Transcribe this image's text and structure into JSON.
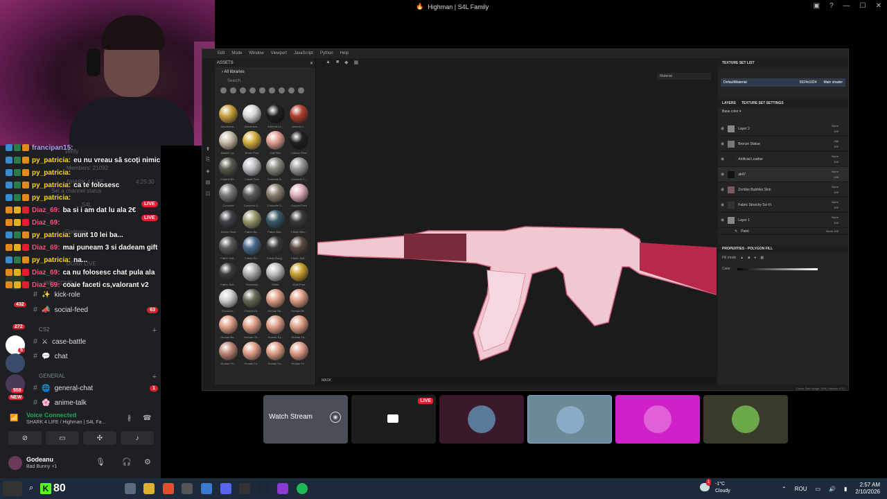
{
  "window": {
    "title": "Highman | S4L Family"
  },
  "chat": [
    {
      "user": "francipan15:",
      "msg": "",
      "color": "#bf94ff"
    },
    {
      "user": "py_patricia:",
      "msg": "eu nu vreau să scoți nimic",
      "color": "#ffd700"
    },
    {
      "user": "py_patricia:",
      "msg": "",
      "color": "#ffd700"
    },
    {
      "user": "py_patricia:",
      "msg": "ca te folosesc",
      "color": "#ffd700"
    },
    {
      "user": "py_patricia:",
      "msg": "",
      "color": "#ffd700"
    },
    {
      "user": "Diaz_69:",
      "msg": "ba si i am dat lu ala 2€",
      "color": "#ff4a7a"
    },
    {
      "user": "Diaz_69:",
      "msg": "",
      "color": "#ff4a7a"
    },
    {
      "user": "py_patricia:",
      "msg": "sunt 10 lei ba...",
      "color": "#ffd700"
    },
    {
      "user": "Diaz_69:",
      "msg": "mai puneam 3 si dadeam gift",
      "color": "#ff4a7a"
    },
    {
      "user": "py_patricia:",
      "msg": "na...",
      "color": "#ffd700"
    },
    {
      "user": "Diaz_69:",
      "msg": "ca nu folosesc chat pula ala",
      "color": "#ff4a7a"
    },
    {
      "user": "Diaz_69:",
      "msg": "coaie faceti cs,valorant v2",
      "color": "#ff4a7a"
    }
  ],
  "ghost": {
    "verify": "verify",
    "members": "Members: 21092",
    "shark": "SHARK 4 LIFE",
    "time": "4:25:30",
    "status": "Set a channel status",
    "s4l": "S4L",
    "godeanu": "Godeanu",
    "doar_live": "DOAR LIVE",
    "welcome": "WELCOME",
    "live": "LIVE"
  },
  "channels": [
    {
      "name": "kick-role",
      "emoji": "✨",
      "count": ""
    },
    {
      "name": "social-feed",
      "emoji": "📣",
      "count": "63"
    },
    {
      "name": "case-battle",
      "emoji": "⚔",
      "count": ""
    },
    {
      "name": "chat",
      "emoji": "💬",
      "count": ""
    },
    {
      "name": "general-chat",
      "emoji": "🌐",
      "count": "1"
    },
    {
      "name": "anime-talk",
      "emoji": "🌸",
      "count": ""
    }
  ],
  "categories": {
    "cs2": "CS2",
    "general": "GENERAL"
  },
  "server_badges": {
    "b432": "432",
    "b272": "272",
    "b5": "5",
    "b558": "558",
    "new": "NEW"
  },
  "voice": {
    "status": "Voice Connected",
    "channel": "SHARK 4 LIFE / Highman | S4L Fa..."
  },
  "user": {
    "name": "Godeanu",
    "status": "Bad Bunny +1"
  },
  "painter": {
    "menu": [
      "Edit",
      "Mode",
      "Window",
      "Viewport",
      "JavaScript",
      "Python",
      "Help"
    ],
    "assets_title": "ASSETS",
    "all_libraries": "All libraries",
    "search": "Search",
    "materials": [
      {
        "name": "Aluminium...",
        "color": "#c9a040"
      },
      {
        "name": "Aluminium...",
        "color": "#d8d8d8"
      },
      {
        "name": "Artificial Le...",
        "color": "#1e1e1e"
      },
      {
        "name": "Autumn L...",
        "color": "#b04030"
      },
      {
        "name": "Baked Lig...",
        "color": "#c8bca8"
      },
      {
        "name": "Brass Pure",
        "color": "#d4b040"
      },
      {
        "name": "Calf Skin",
        "color": "#e0a090"
      },
      {
        "name": "Carbon Fiber",
        "color": "#202020"
      },
      {
        "name": "Coated Me...",
        "color": "#5a5a50"
      },
      {
        "name": "Cobalt Pure",
        "color": "#c0c0c8"
      },
      {
        "name": "Concrete B...",
        "color": "#8a8a80"
      },
      {
        "name": "Concrete C...",
        "color": "#9a9a98"
      },
      {
        "name": "Concrete",
        "color": "#7a7a78"
      },
      {
        "name": "Concrete S...",
        "color": "#5a5a58"
      },
      {
        "name": "Concrete S...",
        "color": "#8a8070"
      },
      {
        "name": "Copper Pure",
        "color": "#e0b0b8"
      },
      {
        "name": "Denim Rivet",
        "color": "#404048"
      },
      {
        "name": "Fabric Ba...",
        "color": "#9a9a70"
      },
      {
        "name": "Fabric Bas...",
        "color": "#3a5a68"
      },
      {
        "name": "Fabric Bea...",
        "color": "#3a3a3a"
      },
      {
        "name": "Fabric Knit...",
        "color": "#5a5a5a"
      },
      {
        "name": "Fabric Ro...",
        "color": "#4a6a8a"
      },
      {
        "name": "Fabric Roug...",
        "color": "#3a3a3a"
      },
      {
        "name": "Fabric Soft...",
        "color": "#5a4a42"
      },
      {
        "name": "Fabric Suit...",
        "color": "#3a3a3a"
      },
      {
        "name": "Footprints",
        "color": "#b0b0b0"
      },
      {
        "name": "Glitter",
        "color": "#c0c0c0"
      },
      {
        "name": "Gold Pure",
        "color": "#c8a030"
      },
      {
        "name": "Gouache...",
        "color": "#d0d0d0"
      },
      {
        "name": "Ground Gr...",
        "color": "#6a6a58"
      },
      {
        "name": "Human Ba...",
        "color": "#e0a088"
      },
      {
        "name": "Human Be...",
        "color": "#e0a088"
      },
      {
        "name": "Human Bu...",
        "color": "#e0a088"
      },
      {
        "name": "Human Ch...",
        "color": "#e0a088"
      },
      {
        "name": "Human Ey...",
        "color": "#e0a088"
      },
      {
        "name": "Human Fa...",
        "color": "#e0a088"
      },
      {
        "name": "Human Fe...",
        "color": "#c08878"
      },
      {
        "name": "Human Fo...",
        "color": "#e0a088"
      },
      {
        "name": "Human Fo...",
        "color": "#e0a088"
      },
      {
        "name": "Human Fo...",
        "color": "#e0a088"
      }
    ],
    "material_dropdown": "Material",
    "mask_label": "MASK",
    "texture_set_list": "TEXTURE SET LIST",
    "texture_set": {
      "name": "DefaultMaterial",
      "res": "5024x1024",
      "shader": "Main shader"
    },
    "layers_tab": "LAYERS",
    "tss_tab": "TEXTURE SET SETTINGS",
    "base_color": "Base color",
    "layers": [
      {
        "name": "Layer 2",
        "blend": "Norm",
        "opacity": "100",
        "color": "#888"
      },
      {
        "name": "Bronze Statue",
        "blend": "dlgt",
        "opacity": "100",
        "color": "#777"
      },
      {
        "name": "Artificial Leather",
        "blend": "Norm",
        "opacity": "100",
        "color": "#222"
      },
      {
        "name": "ak47",
        "blend": "Norm",
        "opacity": "100",
        "color": "#111"
      },
      {
        "name": "Zombie Bubbles Skin",
        "blend": "Norm",
        "opacity": "100",
        "color": "#7a5a5a"
      },
      {
        "name": "Fabric Stretchy Sci-Fi",
        "blend": "Norm",
        "opacity": "100",
        "color": "#333"
      },
      {
        "name": "Layer 1",
        "blend": "Norm",
        "opacity": "100",
        "color": "#888"
      }
    ],
    "paint_layer": {
      "name": "Paint",
      "blend": "Norm",
      "opacity": "100"
    },
    "properties": "PROPERTIES - POLYGON FILL",
    "fill_mode": "Fill mode",
    "color_label": "Color",
    "status": "Cache Disk Usage: 38% | Version: 8.3.1"
  },
  "streams": {
    "watch": "Watch Stream",
    "live": "LIVE"
  },
  "taskbar": {
    "k_value": "80",
    "weather_temp": "-1°C",
    "weather_desc": "Cloudy",
    "weather_alert": "1",
    "lang": "ROU",
    "time": "2:57 AM",
    "date": "2/10/2026"
  },
  "colors": {
    "accent_live": "#e02030",
    "kick_green": "#53fc18",
    "discord_green": "#23a55a",
    "gun_pink": "#f0b0c0"
  }
}
